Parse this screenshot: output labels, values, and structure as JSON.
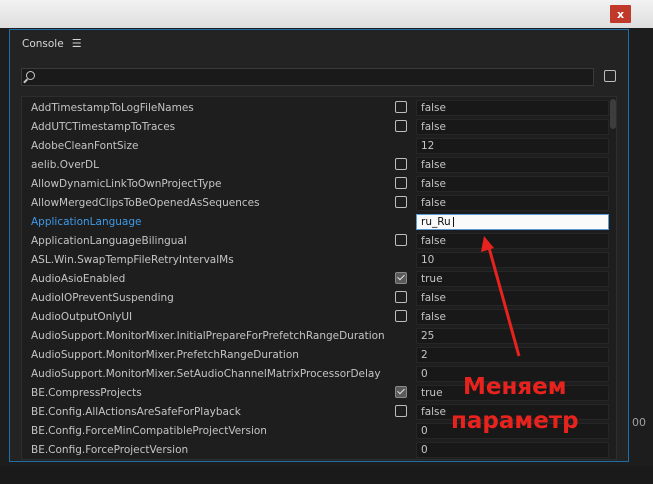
{
  "window": {
    "title": "Console",
    "menu_icon": "hamburger-icon",
    "close_label": "x"
  },
  "search": {
    "placeholder": "",
    "value": ""
  },
  "rows": [
    {
      "name": "AddTimestampToLogFileNames",
      "checkbox": true,
      "checked": false,
      "value": "false"
    },
    {
      "name": "AddUTCTimestampToTraces",
      "checkbox": true,
      "checked": false,
      "value": "false"
    },
    {
      "name": "AdobeCleanFontSize",
      "checkbox": false,
      "checked": false,
      "value": "12"
    },
    {
      "name": "aelib.OverDL",
      "checkbox": true,
      "checked": false,
      "value": "false"
    },
    {
      "name": "AllowDynamicLinkToOwnProjectType",
      "checkbox": true,
      "checked": false,
      "value": "false"
    },
    {
      "name": "AllowMergedClipsToBeOpenedAsSequences",
      "checkbox": true,
      "checked": false,
      "value": "false"
    },
    {
      "name": "ApplicationLanguage",
      "checkbox": false,
      "checked": false,
      "value": "ru_Ru",
      "selected": true
    },
    {
      "name": "ApplicationLanguageBilingual",
      "checkbox": true,
      "checked": false,
      "value": "false"
    },
    {
      "name": "ASL.Win.SwapTempFileRetryIntervalMs",
      "checkbox": false,
      "checked": false,
      "value": "10"
    },
    {
      "name": "AudioAsioEnabled",
      "checkbox": true,
      "checked": true,
      "value": "true"
    },
    {
      "name": "AudioIOPreventSuspending",
      "checkbox": true,
      "checked": false,
      "value": "false"
    },
    {
      "name": "AudioOutputOnlyUI",
      "checkbox": true,
      "checked": false,
      "value": "false"
    },
    {
      "name": "AudioSupport.MonitorMixer.InitialPrepareForPrefetchRangeDuration",
      "checkbox": false,
      "checked": false,
      "value": "25"
    },
    {
      "name": "AudioSupport.MonitorMixer.PrefetchRangeDuration",
      "checkbox": false,
      "checked": false,
      "value": "2"
    },
    {
      "name": "AudioSupport.MonitorMixer.SetAudioChannelMatrixProcessorDelay",
      "checkbox": false,
      "checked": false,
      "value": "0"
    },
    {
      "name": "BE.CompressProjects",
      "checkbox": true,
      "checked": true,
      "value": "true"
    },
    {
      "name": "BE.Config.AllActionsAreSafeForPlayback",
      "checkbox": true,
      "checked": false,
      "value": "false"
    },
    {
      "name": "BE.Config.ForceMinCompatibleProjectVersion",
      "checkbox": false,
      "checked": false,
      "value": "0"
    },
    {
      "name": "BE.Config.ForceProjectVersion",
      "checkbox": false,
      "checked": false,
      "value": "0"
    }
  ],
  "annotation": {
    "line1": "Меняем",
    "line2": "параметр",
    "color": "#e8231e"
  },
  "side_text": "00",
  "colors": {
    "accent": "#1f6fa8",
    "selected_text": "#3d9ae8",
    "background": "#232323"
  }
}
